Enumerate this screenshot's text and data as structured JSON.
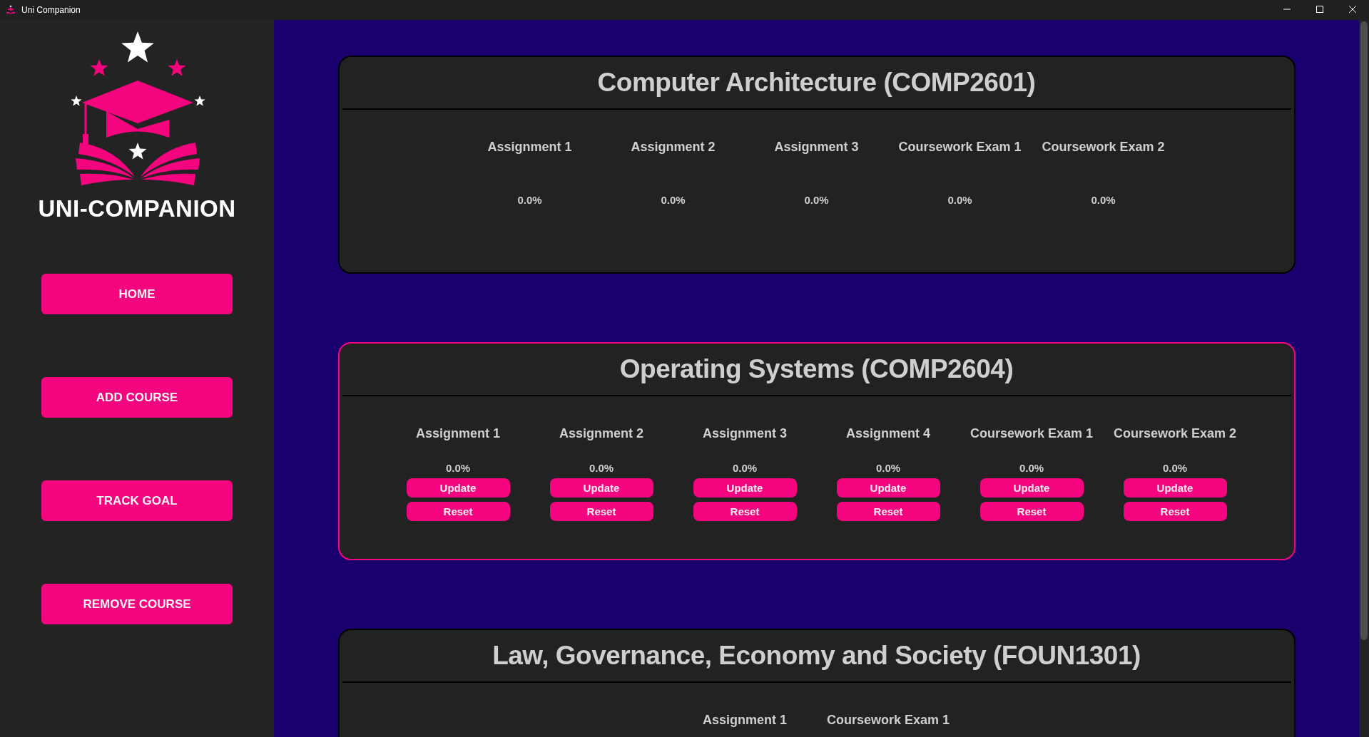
{
  "window": {
    "title": "Uni Companion"
  },
  "sidebar": {
    "logo_text": "UNI-COMPANION",
    "nav": [
      {
        "label": "HOME"
      },
      {
        "label": "ADD COURSE"
      },
      {
        "label": "TRACK GOAL"
      },
      {
        "label": "REMOVE COURSE"
      }
    ]
  },
  "courses": [
    {
      "title": "Computer Architecture (COMP2601)",
      "selected": false,
      "assessments": [
        {
          "name": "Assignment 1",
          "grade": "0.0%"
        },
        {
          "name": "Assignment 2",
          "grade": "0.0%"
        },
        {
          "name": "Assignment 3",
          "grade": "0.0%"
        },
        {
          "name": "Coursework Exam 1",
          "grade": "0.0%"
        },
        {
          "name": "Coursework Exam 2",
          "grade": "0.0%"
        }
      ]
    },
    {
      "title": "Operating Systems (COMP2604)",
      "selected": true,
      "assessments": [
        {
          "name": "Assignment 1",
          "grade": "0.0%",
          "actions": [
            "Update",
            "Reset"
          ]
        },
        {
          "name": "Assignment 2",
          "grade": "0.0%",
          "actions": [
            "Update",
            "Reset"
          ]
        },
        {
          "name": "Assignment 3",
          "grade": "0.0%",
          "actions": [
            "Update",
            "Reset"
          ]
        },
        {
          "name": "Assignment 4",
          "grade": "0.0%",
          "actions": [
            "Update",
            "Reset"
          ]
        },
        {
          "name": "Coursework Exam 1",
          "grade": "0.0%",
          "actions": [
            "Update",
            "Reset"
          ]
        },
        {
          "name": "Coursework Exam 2",
          "grade": "0.0%",
          "actions": [
            "Update",
            "Reset"
          ]
        }
      ]
    },
    {
      "title": "Law, Governance, Economy and Society (FOUN1301)",
      "selected": false,
      "assessments": [
        {
          "name": "Assignment 1"
        },
        {
          "name": "Coursework Exam 1"
        }
      ]
    }
  ]
}
